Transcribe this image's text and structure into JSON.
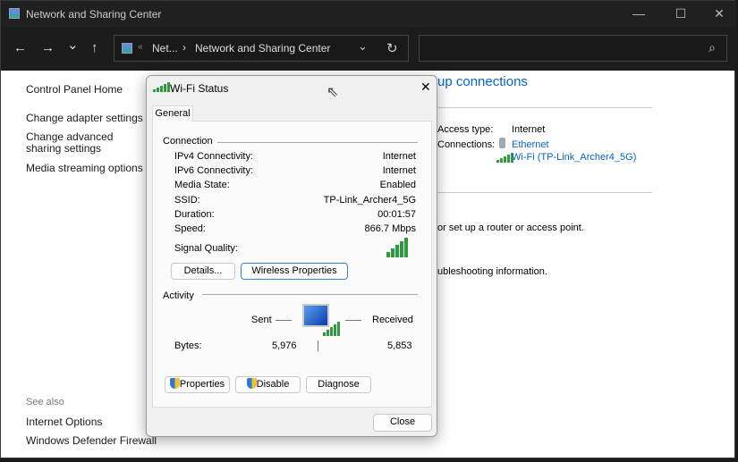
{
  "window": {
    "title": "Network and Sharing Center",
    "minimize": "—",
    "maximize": "☐",
    "close": "✕"
  },
  "toolbar": {
    "back": "←",
    "forward": "→",
    "recent": "⌄",
    "up": "↑",
    "breadcrumb_sep": "«",
    "crumb1": "Net...",
    "chevron": "›",
    "crumb2": "Network and Sharing Center",
    "dropdown": "⌄",
    "refresh": "↻",
    "search_placeholder": "",
    "search_icon": "⌕"
  },
  "sidebar": {
    "items": [
      "Control Panel Home",
      "Change adapter settings",
      "Change advanced sharing settings",
      "Media streaming options"
    ],
    "see_also": "See also",
    "see_also_items": [
      "Internet Options",
      "Windows Defender Firewall"
    ]
  },
  "main": {
    "heading": "up connections",
    "access_type_label": "Access type:",
    "access_type_value": "Internet",
    "connections_label": "Connections:",
    "ethernet": "Ethernet",
    "wifi": "Wi-Fi (TP-Link_Archer4_5G)",
    "router_text": "or set up a router or access point.",
    "troubleshoot_text": "ubleshooting information."
  },
  "dialog": {
    "title": "Wi-Fi Status",
    "close": "✕",
    "tab": "General",
    "connection_label": "Connection",
    "rows": [
      {
        "label": "IPv4 Connectivity:",
        "value": "Internet"
      },
      {
        "label": "IPv6 Connectivity:",
        "value": "Internet"
      },
      {
        "label": "Media State:",
        "value": "Enabled"
      },
      {
        "label": "SSID:",
        "value": "TP-Link_Archer4_5G"
      },
      {
        "label": "Duration:",
        "value": "00:01:57"
      },
      {
        "label": "Speed:",
        "value": "866.7 Mbps"
      }
    ],
    "signal_label": "Signal Quality:",
    "signal_bars": 5,
    "details_button": "Details...",
    "wireless_button": "Wireless Properties",
    "activity_label": "Activity",
    "sent": "Sent",
    "received": "Received",
    "bytes_label": "Bytes:",
    "bytes_sent": "5,976",
    "bytes_received": "5,853",
    "properties_button": "Properties",
    "disable_button": "Disable",
    "diagnose_button": "Diagnose",
    "close_button": "Close"
  }
}
